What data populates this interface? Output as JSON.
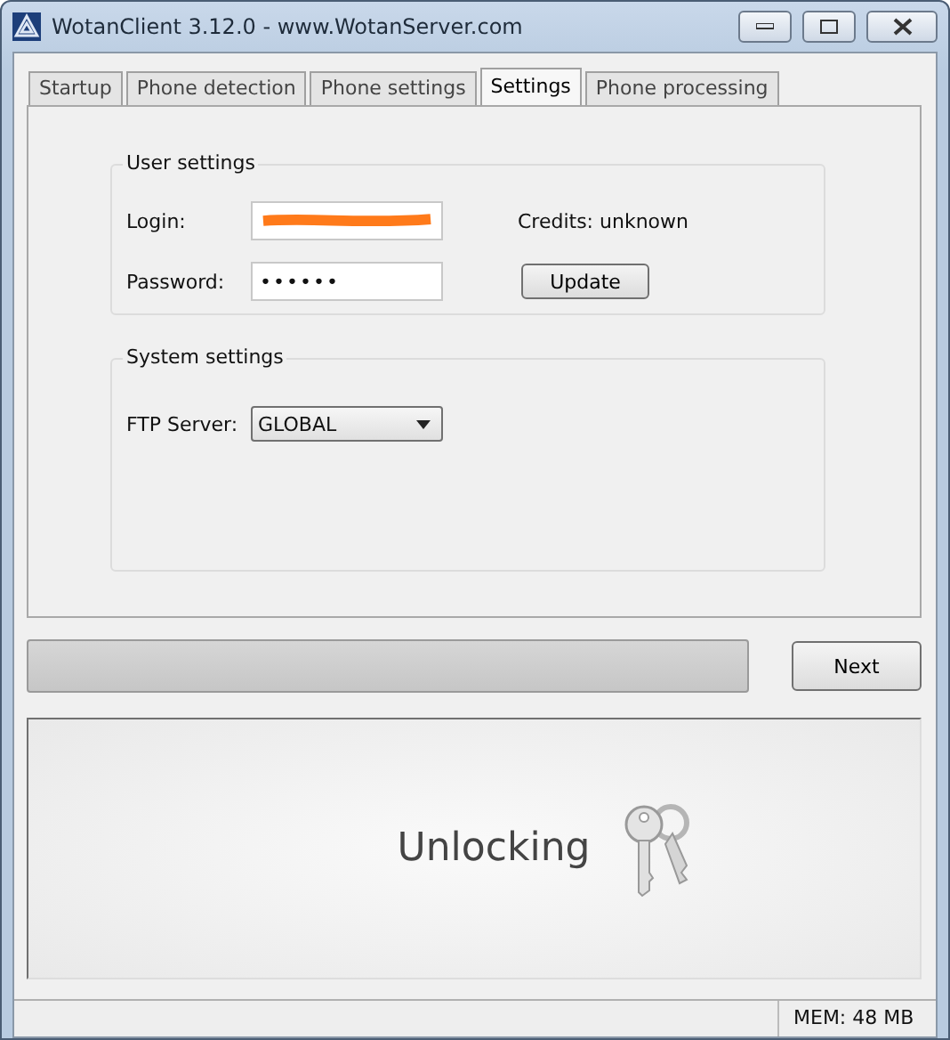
{
  "window": {
    "title": "WotanClient 3.12.0 - www.WotanServer.com"
  },
  "tabs": [
    {
      "label": "Startup",
      "selected": false
    },
    {
      "label": "Phone detection",
      "selected": false
    },
    {
      "label": "Phone settings",
      "selected": false
    },
    {
      "label": "Settings",
      "selected": true
    },
    {
      "label": "Phone processing",
      "selected": false
    }
  ],
  "user_settings": {
    "title": "User settings",
    "login_label": "Login:",
    "password_label": "Password:",
    "password_value": "••••••",
    "credits": "Credits: unknown",
    "update_button": "Update"
  },
  "system_settings": {
    "title": "System settings",
    "ftp_label": "FTP Server:",
    "ftp_value": "GLOBAL"
  },
  "progress": {
    "level": 0
  },
  "next_button": "Next",
  "status_panel": {
    "text": "Unlocking"
  },
  "status_bar": {
    "memory": "MEM: 48 MB"
  }
}
